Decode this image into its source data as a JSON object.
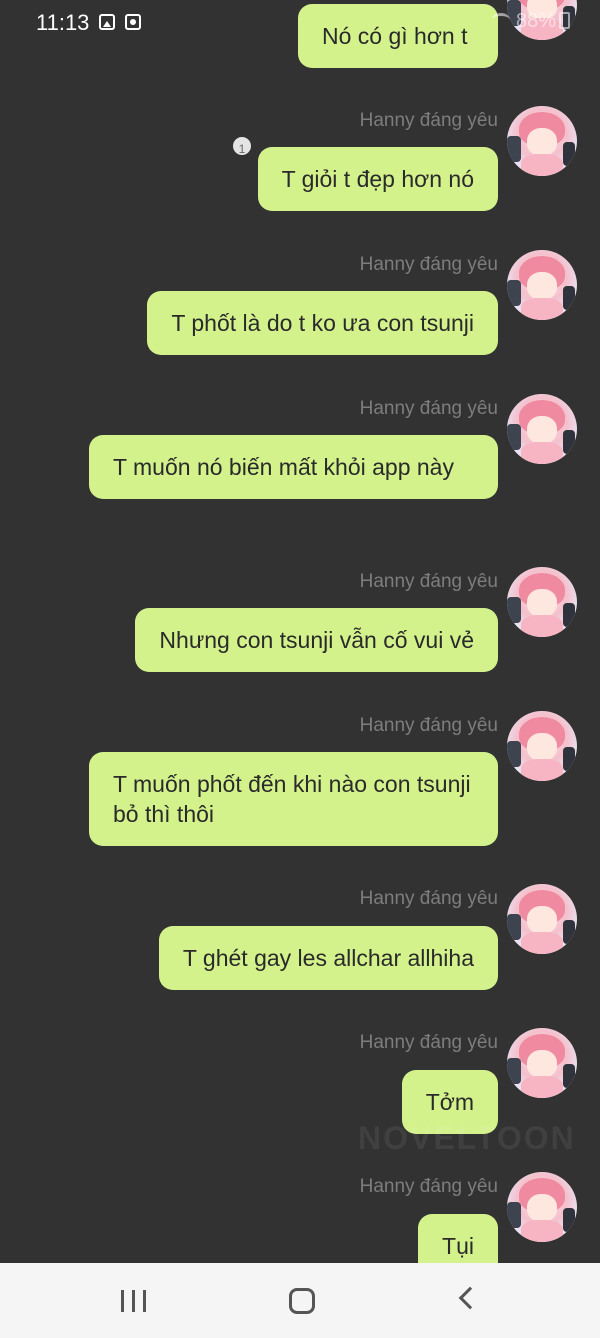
{
  "status_bar": {
    "time": "11:13",
    "battery": "88%",
    "icons": [
      "image-icon",
      "record-icon",
      "wifi-icon",
      "signal-icon",
      "battery-icon"
    ]
  },
  "chat": {
    "sender_name": "Hanny đáng yêu",
    "messages": [
      {
        "text": "Nó có gì hơn t"
      },
      {
        "text": "T giỏi t đẹp hơn nó",
        "badge": "1"
      },
      {
        "text": "T phốt là do t ko ưa con tsunji"
      },
      {
        "text": "T muốn nó biến mất khỏi app này"
      },
      {
        "text": "Nhưng con tsunji vẫn cố vui vẻ"
      },
      {
        "text": "T muốn phốt đến khi nào con tsunji bỏ thì thôi"
      },
      {
        "text": "T ghét gay les allchar allhiha"
      },
      {
        "text": "Tởm"
      },
      {
        "text": "Tụi"
      }
    ]
  },
  "watermark": "NOVELTOON",
  "nav_bar": {
    "icons": [
      "recents-icon",
      "home-icon",
      "back-icon"
    ]
  },
  "colors": {
    "background": "#323232",
    "bubble": "#d4f28c",
    "sender_name": "#7d7d7d",
    "nav_bar": "#f5f5f5"
  }
}
